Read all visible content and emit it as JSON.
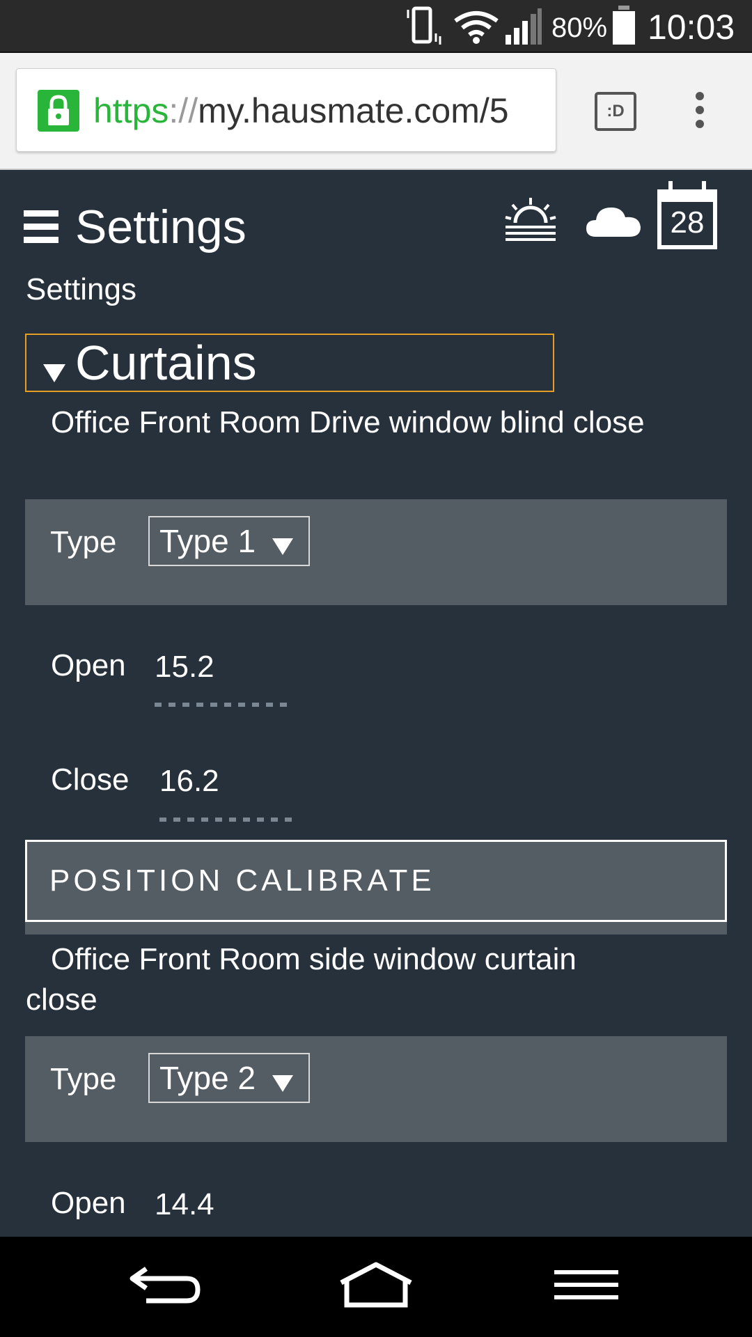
{
  "status_bar": {
    "battery": "80%",
    "time": "10:03",
    "icons": [
      "vibrate-icon",
      "wifi-icon",
      "signal-icon",
      "battery-icon"
    ]
  },
  "browser": {
    "url_scheme": "https",
    "url_separator": "://",
    "url_host": "my.hausmate.com/5",
    "tab_switcher_label": ":D",
    "icons": [
      "lock-icon",
      "tab-switcher-icon",
      "overflow-menu-icon"
    ]
  },
  "header": {
    "title": "Settings",
    "calendar_day": "28",
    "icons": [
      "menu-icon",
      "sunrise-icon",
      "cloud-icon",
      "calendar-icon"
    ]
  },
  "breadcrumb": "Settings",
  "section": {
    "title": "Curtains",
    "expanded": true
  },
  "devices": [
    {
      "name": "Office Front Room Drive window blind close",
      "type_label": "Type",
      "type_value": "Type 1",
      "open_label": "Open",
      "open_value": "15.2",
      "close_label": "Close",
      "close_value": "16.2",
      "button_label": "POSITION CALIBRATE"
    },
    {
      "name": "Office Front Room side window curtain close",
      "type_label": "Type",
      "type_value": "Type 2",
      "open_label": "Open",
      "open_value": "14.4"
    }
  ],
  "nav_bar": {
    "icons": [
      "back-icon",
      "home-icon",
      "recent-apps-icon"
    ]
  },
  "colors": {
    "page_bg": "#27313b",
    "panel_bg": "#545c64",
    "section_border": "#e5a023",
    "secure_green": "#29b53a"
  }
}
